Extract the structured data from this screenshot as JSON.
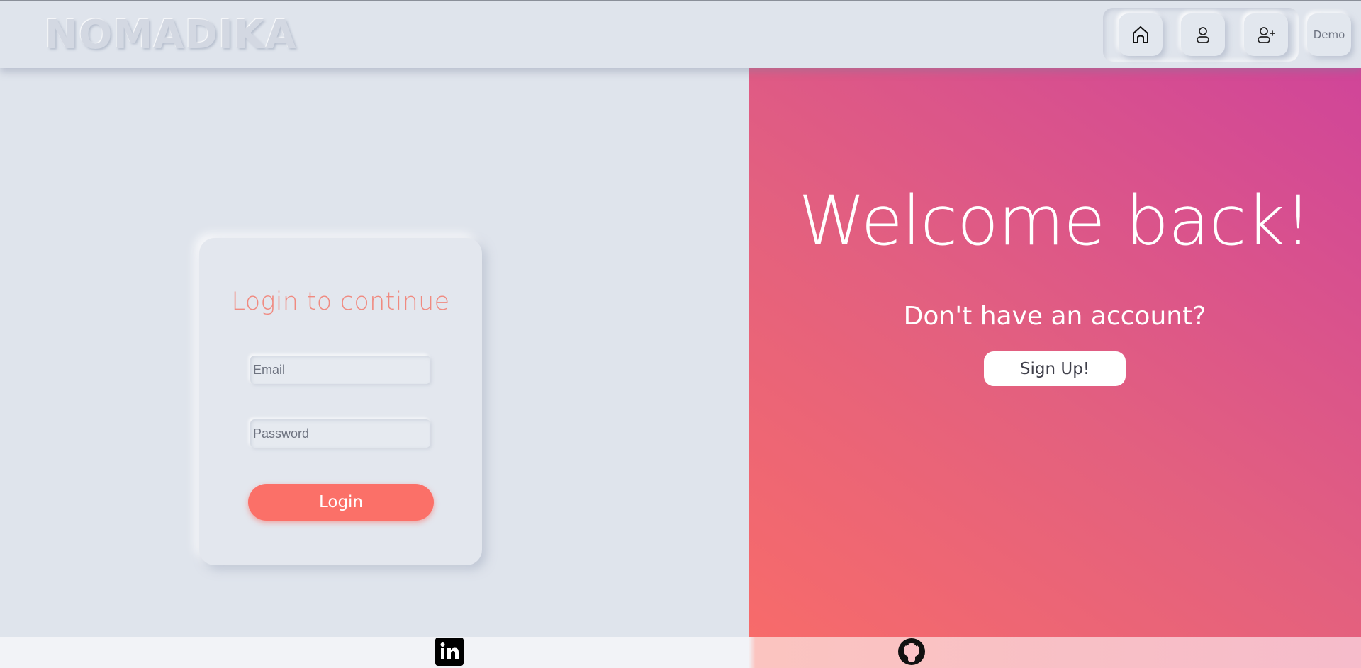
{
  "header": {
    "brand": "NOMADIKA",
    "nav": [
      {
        "name": "home",
        "icon": "home-icon"
      },
      {
        "name": "profile",
        "icon": "user-icon"
      },
      {
        "name": "register",
        "icon": "user-plus-icon"
      },
      {
        "name": "demo",
        "label": "Demo"
      }
    ]
  },
  "login_card": {
    "title": "Login to continue",
    "email_placeholder": "Email",
    "password_placeholder": "Password",
    "login_label": "Login"
  },
  "welcome_panel": {
    "heading": "Welcome back!",
    "subtitle": "Don't have an account?",
    "signup_label": "Sign Up!"
  },
  "footer": {
    "links": [
      {
        "name": "linkedin",
        "icon": "linkedin-icon"
      },
      {
        "name": "github",
        "icon": "github-icon"
      }
    ]
  },
  "colors": {
    "accent": "#fb7068",
    "title": "#f08a80",
    "gradient_start": "#f76b6a",
    "gradient_end": "#d04599",
    "background": "#dfe4ec"
  }
}
